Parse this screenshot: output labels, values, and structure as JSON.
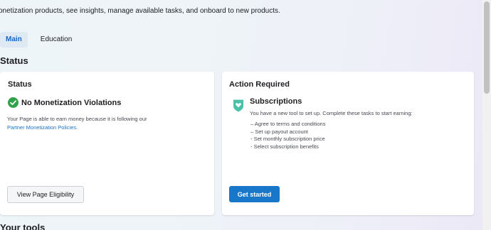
{
  "header": {
    "intro_text": "onetization products, see insights, manage available tasks, and onboard to new products."
  },
  "tabs": [
    {
      "label": "Main",
      "active": true
    },
    {
      "label": "Education",
      "active": false
    }
  ],
  "section_title": "Status",
  "status_card": {
    "title": "Status",
    "icon": "check-circle-icon",
    "heading": "No Monetization Violations",
    "body_text": "Your Page is able to earn money because it is following our",
    "link_text": "Partner Monetization Policies",
    "link_suffix": ".",
    "button_label": "View Page Eligibility",
    "status_color": "#31a24c"
  },
  "action_card": {
    "title": "Action Required",
    "icon": "heart-shield-icon",
    "heading": "Subscriptions",
    "description": "You have a new tool to set up. Complete these tasks to start earning:",
    "tasks": [
      "– Agree to terms and conditions",
      "– Set up payout account",
      "- Set monthly subscription price",
      "- Select subscription benefits"
    ],
    "button_label": "Get started",
    "accent_color": "#1877c9",
    "icon_color": "#4dc0a8"
  },
  "next_section_title": "Your tools"
}
